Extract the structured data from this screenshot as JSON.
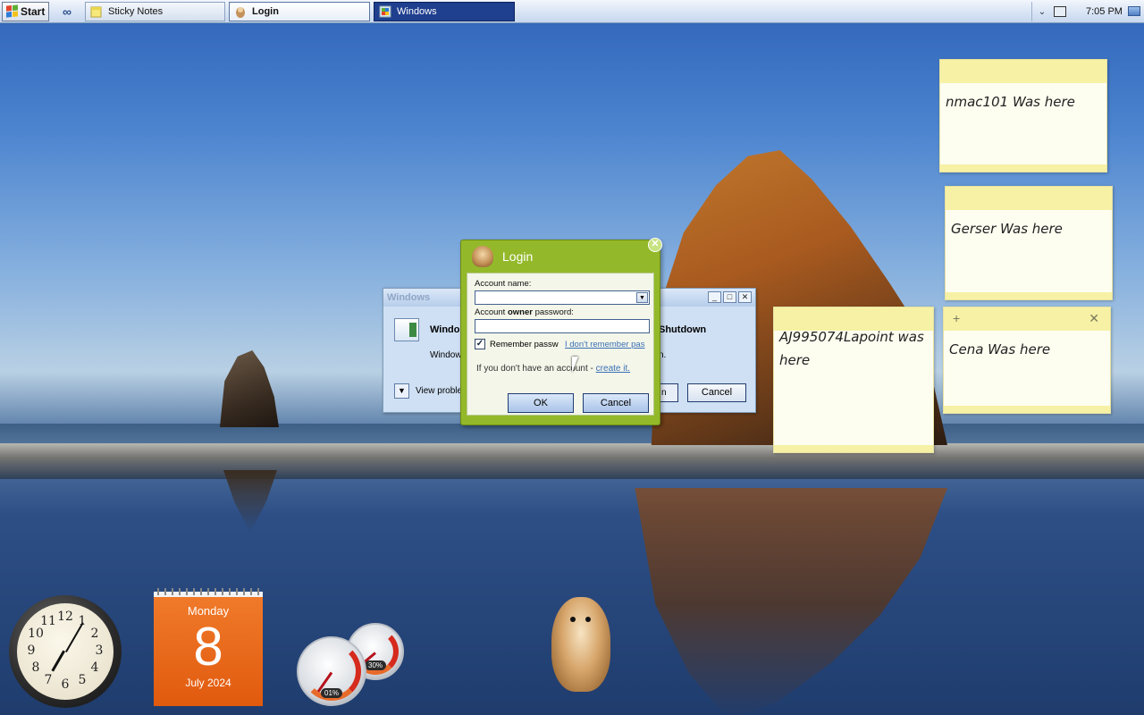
{
  "taskbar": {
    "start_label": "Start",
    "tasks": [
      {
        "label": "Sticky Notes",
        "icon": "sticky-notes-icon"
      },
      {
        "label": "Login",
        "icon": "hamster-icon"
      },
      {
        "label": "Windows",
        "icon": "windows-icon"
      }
    ],
    "clock": "7:05 PM"
  },
  "windows_dialog": {
    "title": "Windows",
    "heading_left": "Windo",
    "heading_right": "Shutdown",
    "text_left": "Window",
    "text_right": "n.",
    "details_label": "View proble",
    "button_fragment": "n",
    "cancel_label": "Cancel"
  },
  "login_dialog": {
    "title": "Login",
    "account_name_label": "Account name:",
    "account_name_value": "",
    "password_label_pre": "Account ",
    "password_label_bold": "owner",
    "password_label_post": " password:",
    "password_value": "",
    "remember_label": "Remember passw",
    "remember_checked": true,
    "forgot_link": "I don't remember pas",
    "no_account_text": "If you don't have an account - ",
    "create_link": "create it.",
    "ok_label": "OK",
    "cancel_label": "Cancel"
  },
  "sticky_notes": [
    {
      "text": "nmac101 Was here"
    },
    {
      "text": "Gerser Was here"
    },
    {
      "text": "AJ995074Lapoint was here"
    },
    {
      "text": "Cena Was here"
    }
  ],
  "gadgets": {
    "clock_numbers": [
      "12",
      "1",
      "2",
      "3",
      "4",
      "5",
      "6",
      "7",
      "8",
      "9",
      "10",
      "11"
    ],
    "calendar": {
      "day_of_week": "Monday",
      "day": "8",
      "month_year": "July 2024"
    },
    "cpu_meter": {
      "cpu": "01%",
      "memory": "30%"
    }
  }
}
